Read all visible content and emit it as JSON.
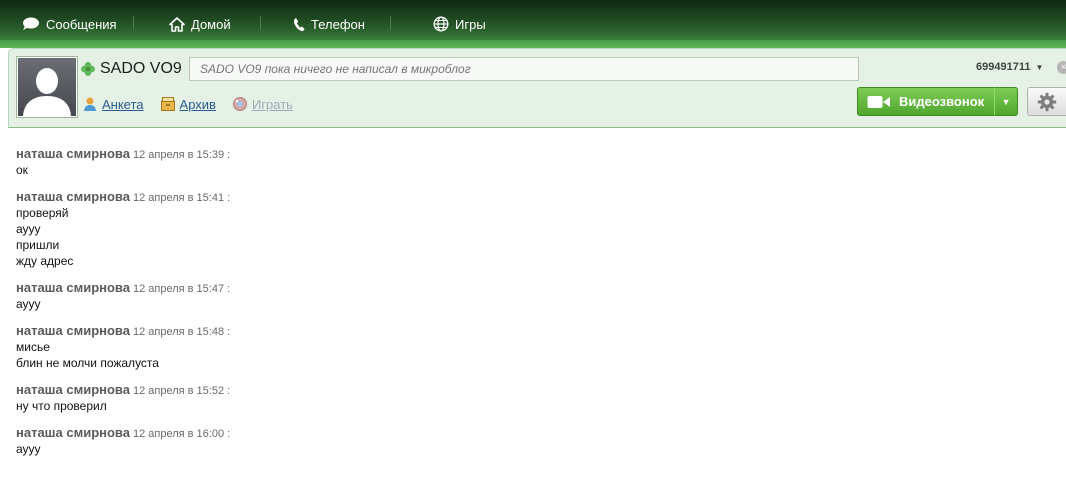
{
  "nav": {
    "tabs": [
      {
        "label": "Сообщения",
        "icon": "speech-bubble-icon"
      },
      {
        "label": "Домой",
        "icon": "home-icon"
      },
      {
        "label": "Телефон",
        "icon": "phone-icon"
      },
      {
        "label": "Игры",
        "icon": "globe-icon"
      }
    ]
  },
  "contact": {
    "name": "SADO VO9",
    "status_placeholder": "SADO VO9 пока ничего не написал в микроблог",
    "links": [
      {
        "label": "Анкета",
        "icon": "person-icon",
        "enabled": true
      },
      {
        "label": "Архив",
        "icon": "archive-icon",
        "enabled": true
      },
      {
        "label": "Играть",
        "icon": "games-icon",
        "enabled": false
      }
    ]
  },
  "account": {
    "number": "699491711"
  },
  "actions": {
    "video_call_label": "Видеозвонок"
  },
  "colors": {
    "accent_green": "#5fb85a",
    "link_blue": "#2a5a94"
  },
  "messages": [
    {
      "author": "наташа смирнова",
      "time": "12 апреля в 15:39 :",
      "lines": [
        "ок"
      ]
    },
    {
      "author": "наташа смирнова",
      "time": "12 апреля в 15:41 :",
      "lines": [
        "проверяй",
        "аууу",
        "пришли",
        "жду адрес"
      ]
    },
    {
      "author": "наташа смирнова",
      "time": "12 апреля в 15:47 :",
      "lines": [
        "аууу"
      ]
    },
    {
      "author": "наташа смирнова",
      "time": "12 апреля в 15:48 :",
      "lines": [
        "мисье",
        "блин не молчи пожалуста"
      ]
    },
    {
      "author": "наташа смирнова",
      "time": "12 апреля в 15:52 :",
      "lines": [
        "ну что проверил"
      ]
    },
    {
      "author": "наташа смирнова",
      "time": "12 апреля в 16:00 :",
      "lines": [
        "аууу"
      ]
    }
  ]
}
